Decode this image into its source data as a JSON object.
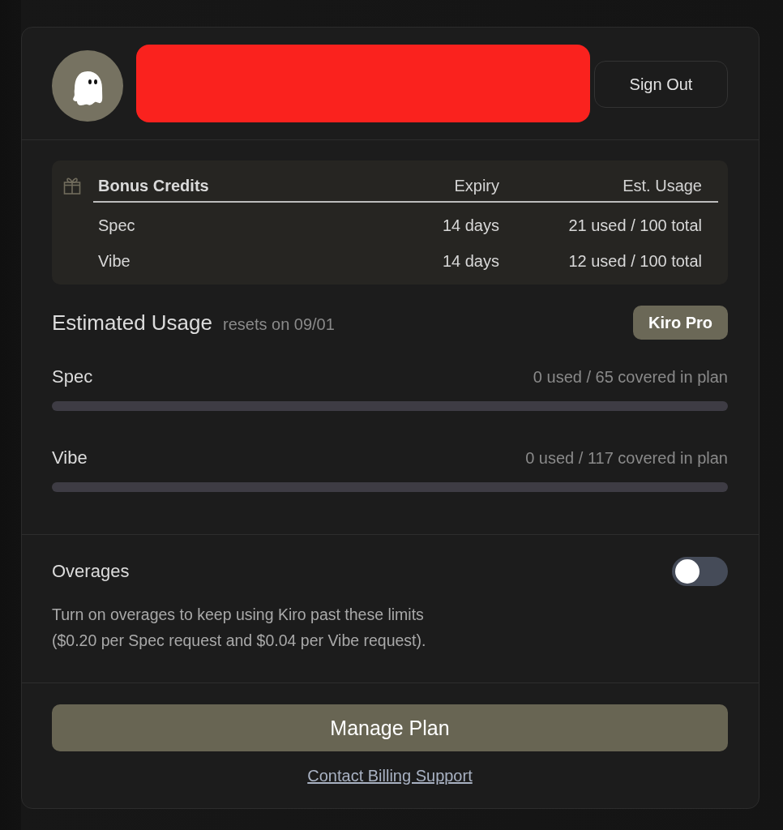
{
  "account": {
    "redacted": true
  },
  "sign_out": "Sign Out",
  "bonus_credits": {
    "columns": [
      "Bonus Credits",
      "Expiry",
      "Est. Usage"
    ],
    "rows": [
      [
        "Spec",
        "14 days",
        "21 used / 100 total"
      ],
      [
        "Vibe",
        "14 days",
        "12 used / 100 total"
      ]
    ]
  },
  "estimated_usage": {
    "title": "Estimated Usage",
    "subtitle": "resets on 09/01",
    "plan_badge": "Kiro Pro",
    "meters": [
      {
        "name": "Spec",
        "reading": "0 used / 65 covered in plan"
      },
      {
        "name": "Vibe",
        "reading": "0 used / 117 covered in plan"
      }
    ]
  },
  "overages": {
    "title": "Overages",
    "on": false,
    "description": "Turn on overages to keep using Kiro past these limits\n($0.20 per Spec request and $0.04 per Vibe request)."
  },
  "manage_plan": "Manage Plan",
  "billing_link": "Contact Billing Support"
}
